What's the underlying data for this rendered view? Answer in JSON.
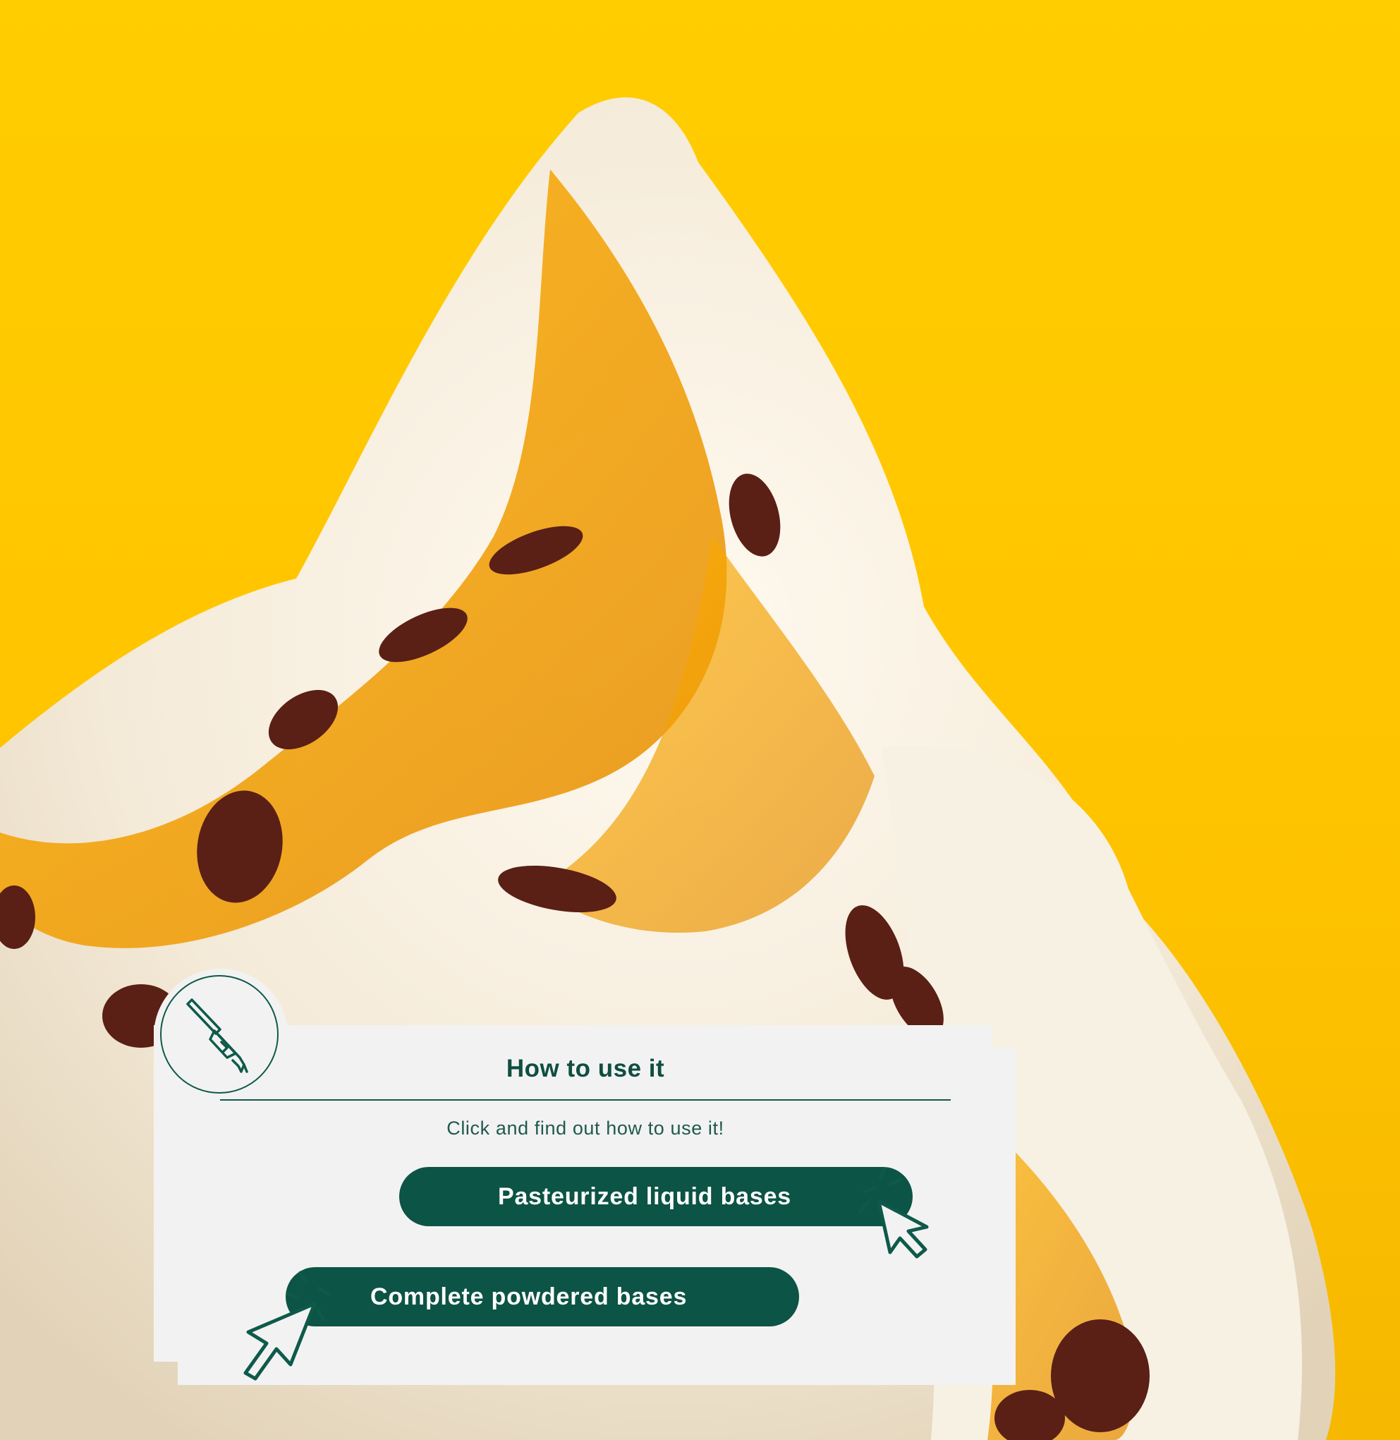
{
  "card": {
    "title": "How to use it",
    "subtitle": "Click and find out how to use it!",
    "buttons": [
      {
        "label": "Pasteurized liquid bases"
      },
      {
        "label": "Complete powdered bases"
      }
    ]
  },
  "colors": {
    "background": "#ffc800",
    "card": "#f3f2f2",
    "accent": "#0c5445"
  },
  "icons": {
    "badge": "brush-dripping-icon",
    "cursor": "click-cursor-icon"
  }
}
